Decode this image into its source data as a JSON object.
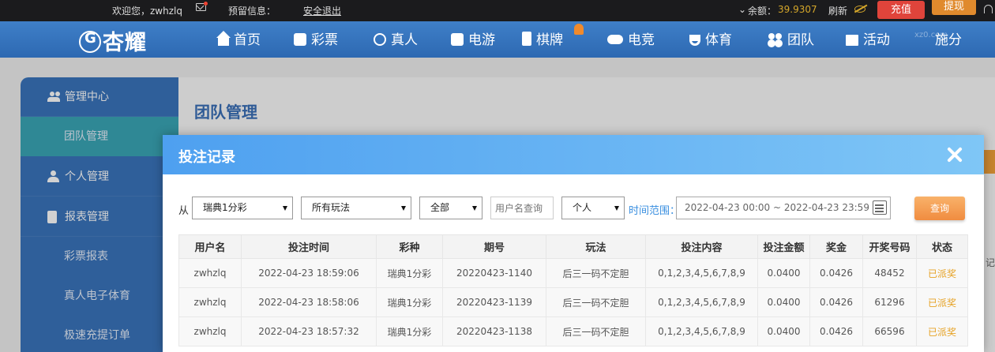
{
  "topbar": {
    "welcome": "欢迎您，zwhzlq",
    "notice_label": "预留信息：",
    "logout": "安全退出",
    "balance_label": "余额：",
    "balance_value": "39.9307",
    "refresh": "刷新",
    "recharge": "充值",
    "withdraw": "提现"
  },
  "nav": {
    "logo": "杏耀",
    "items": [
      "首页",
      "彩票",
      "真人",
      "电游",
      "棋牌",
      "电竞",
      "体育",
      "团队",
      "活动",
      "施分"
    ],
    "watermark": "xz0.com"
  },
  "sidebar": {
    "items": [
      {
        "label": "管理中心",
        "type": "group",
        "icon": "group-icon"
      },
      {
        "label": "团队管理",
        "type": "sub",
        "active": true
      },
      {
        "label": "个人管理",
        "type": "group",
        "icon": "user-icon"
      },
      {
        "label": "报表管理",
        "type": "group",
        "icon": "report-icon"
      },
      {
        "label": "彩票报表",
        "type": "sub"
      },
      {
        "label": "真人电子体育",
        "type": "sub"
      },
      {
        "label": "极速充提订单",
        "type": "sub"
      }
    ]
  },
  "main": {
    "title": "团队管理",
    "side_peek": "记"
  },
  "modal": {
    "title": "投注记录",
    "filters": {
      "from_label": "从",
      "lottery": "瑞典1分彩",
      "play": "所有玩法",
      "scope": "全部",
      "username_placeholder": "用户名查询",
      "member": "个人",
      "time_label": "时间范围：",
      "time_range": "2022-04-23 00:00 ~ 2022-04-23 23:59",
      "query": "查询"
    },
    "table": {
      "columns": [
        "用户名",
        "投注时间",
        "彩种",
        "期号",
        "玩法",
        "投注内容",
        "投注金额",
        "奖金",
        "开奖号码",
        "状态"
      ],
      "rows": [
        [
          "zwhzlq",
          "2022-04-23 18:59:06",
          "瑞典1分彩",
          "20220423-1140",
          "后三一码不定胆",
          "0,1,2,3,4,5,6,7,8,9",
          "0.0400",
          "0.0426",
          "48452",
          "已派奖"
        ],
        [
          "zwhzlq",
          "2022-04-23 18:58:06",
          "瑞典1分彩",
          "20220423-1139",
          "后三一码不定胆",
          "0,1,2,3,4,5,6,7,8,9",
          "0.0400",
          "0.0426",
          "61296",
          "已派奖"
        ],
        [
          "zwhzlq",
          "2022-04-23 18:57:32",
          "瑞典1分彩",
          "20220423-1138",
          "后三一码不定胆",
          "0,1,2,3,4,5,6,7,8,9",
          "0.0400",
          "0.0426",
          "66596",
          "已派奖"
        ]
      ]
    }
  },
  "colors": {
    "nav_blue": "#2d69b2",
    "sidebar_blue": "#3a74bc",
    "active_teal": "#3aa7b6",
    "status_orange": "#e6a224",
    "balance_gold": "#d4a62a"
  }
}
